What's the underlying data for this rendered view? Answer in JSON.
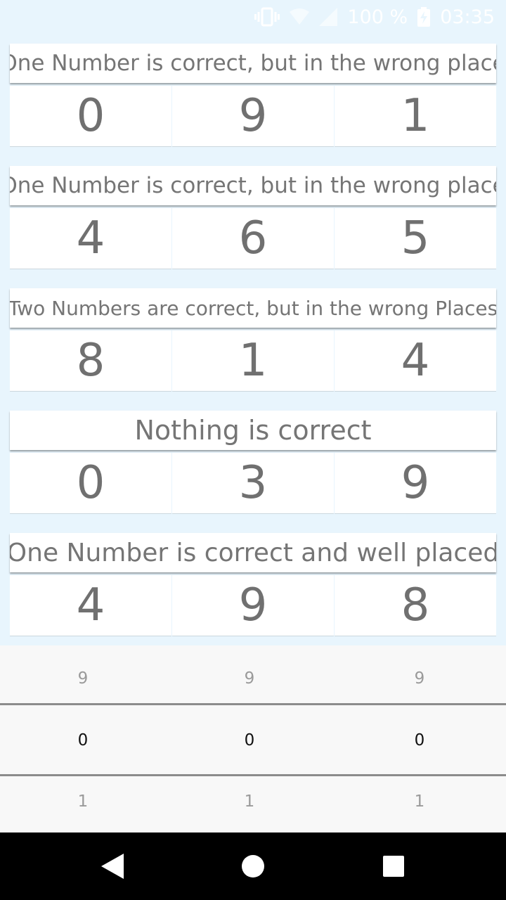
{
  "status_bar": {
    "battery_percent": "100 %",
    "time": "03:35",
    "icons": [
      "vibrate-icon",
      "wifi-icon",
      "signal-icon",
      "battery-charging-icon"
    ]
  },
  "clues": [
    {
      "text": "One Number is correct, but in the wrong place",
      "digits": [
        "0",
        "9",
        "1"
      ]
    },
    {
      "text": "One Number is correct, but in the wrong place",
      "digits": [
        "4",
        "6",
        "5"
      ]
    },
    {
      "text": "Two Numbers are correct, but in the wrong Places",
      "digits": [
        "8",
        "1",
        "4"
      ]
    },
    {
      "text": "Nothing is correct",
      "digits": [
        "0",
        "3",
        "9"
      ]
    },
    {
      "text": "One Number is correct and well placed",
      "digits": [
        "4",
        "9",
        "8"
      ]
    }
  ],
  "picker": {
    "columns": [
      {
        "prev": "9",
        "current": "0",
        "next": "1"
      },
      {
        "prev": "9",
        "current": "0",
        "next": "1"
      },
      {
        "prev": "9",
        "current": "0",
        "next": "1"
      }
    ]
  },
  "nav_bar": {
    "icons": [
      "back-icon",
      "home-icon",
      "recents-icon"
    ]
  },
  "colors": {
    "background": "#e8f5fd",
    "card": "#ffffff",
    "text": "#707070",
    "picker_background": "#f8f8f8",
    "picker_divider": "#8c8c8c",
    "nav_bar": "#000000"
  }
}
